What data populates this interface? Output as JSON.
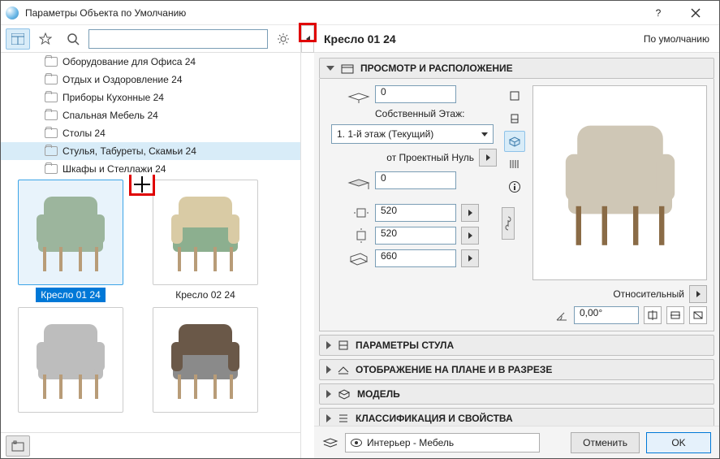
{
  "window": {
    "title": "Параметры Объекта по Умолчанию"
  },
  "toolbar": {
    "search_placeholder": ""
  },
  "tree": {
    "items": [
      {
        "label": "Оборудование для Офиса 24"
      },
      {
        "label": "Отдых и Оздоровление 24"
      },
      {
        "label": "Приборы Кухонные 24"
      },
      {
        "label": "Спальная Мебель 24"
      },
      {
        "label": "Столы 24"
      },
      {
        "label": "Стулья, Табуреты, Скамьи 24"
      },
      {
        "label": "Шкафы и Стеллажи 24"
      }
    ]
  },
  "browser": {
    "items": [
      {
        "label": "Кресло 01 24"
      },
      {
        "label": "Кресло 02 24"
      },
      {
        "label": ""
      },
      {
        "label": ""
      }
    ]
  },
  "header": {
    "object_name": "Кресло 01 24",
    "default_label": "По умолчанию"
  },
  "panels": {
    "preview": {
      "title": "ПРОСМОТР И РАСПОЛОЖЕНИЕ"
    },
    "params": {
      "title": "ПАРАМЕТРЫ СТУЛА"
    },
    "plan": {
      "title": "ОТОБРАЖЕНИЕ НА ПЛАНЕ И В РАЗРЕЗЕ"
    },
    "model": {
      "title": "МОДЕЛЬ"
    },
    "class": {
      "title": "КЛАССИФИКАЦИЯ И СВОЙСТВА"
    }
  },
  "form": {
    "elevation": "0",
    "story_label": "Собственный Этаж:",
    "story_value": "1. 1-й этаж (Текущий)",
    "project_zero_label": "от Проектный Нуль",
    "project_zero_value": "0",
    "width": "520",
    "depth": "520",
    "height": "660",
    "relative_label": "Относительный",
    "angle": "0,00°"
  },
  "footer": {
    "layer": "Интерьер - Мебель",
    "cancel": "Отменить",
    "ok": "OK"
  }
}
